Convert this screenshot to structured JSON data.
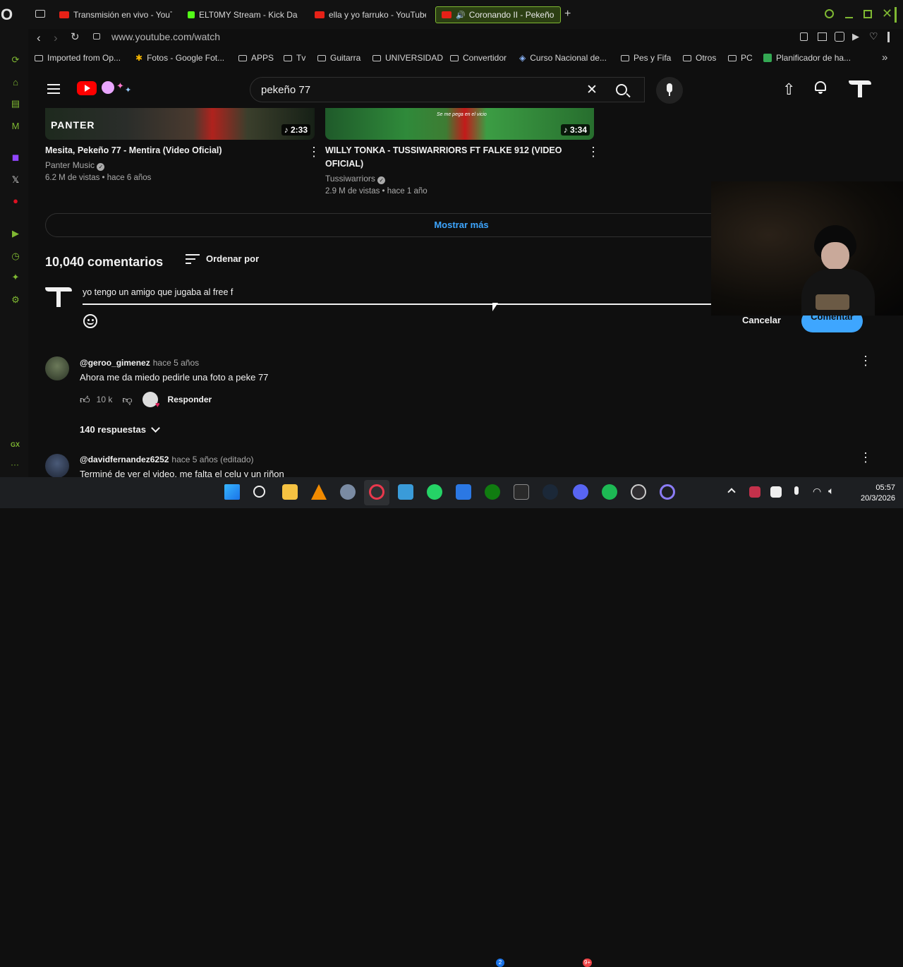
{
  "browser": {
    "tabs": [
      {
        "label": "Transmisión en vivo - YouT",
        "favicon_color": "#e62117",
        "active": false
      },
      {
        "label": "ELT0MY Stream - Kick Da",
        "favicon_color": "#53fc18",
        "active": false
      },
      {
        "label": "ella y yo farruko - YouTube",
        "favicon_color": "#e62117",
        "active": false
      },
      {
        "label": "Coronando II - Pekeño",
        "favicon_color": "#e62117",
        "active": true
      }
    ],
    "new_tab_label": "+",
    "url": "www.youtube.com/watch",
    "bookmarks": [
      "Imported from Op...",
      "Fotos - Google Fot...",
      "APPS",
      "Tv",
      "Guitarra",
      "UNIVERSIDAD",
      "Convertidor",
      "Curso Nacional de...",
      "Pes y Fifa",
      "Otros",
      "PC",
      "Planificador de ha..."
    ],
    "sidebar_label": "GX",
    "accent_color": "#7fb832"
  },
  "youtube": {
    "search_query": "pekeño 77",
    "related_videos": [
      {
        "title_line1": "Mesita, Pekeño 77 - Mentira (Video Oficial)",
        "title_line2": "",
        "channel": "Panter Music",
        "meta": "6.2 M de vistas • hace 6 años",
        "duration": "2:33",
        "thumb_text": "PANTER"
      },
      {
        "title_line1": "WILLY TONKA - TUSSIWARRIORS FT FALKE 912 (VIDEO",
        "title_line2": "OFICIAL)",
        "channel": "Tussiwarriors",
        "meta": "2.9 M de vistas • hace 1 año",
        "duration": "3:34",
        "thumb_text": "Se me pega en el vicio"
      }
    ],
    "show_more_label": "Mostrar más",
    "comments_count": "10,040 comentarios",
    "sort_label": "Ordenar por",
    "comment_draft": "yo tengo un amigo que jugaba al free f",
    "cancel_label": "Cancelar",
    "submit_label": "Comentar",
    "comments": [
      {
        "author": "@geroo_gimenez",
        "time": "hace 5 años",
        "text": "Ahora me da miedo pedirle una foto a peke 77",
        "likes": "10 k",
        "reply_label": "Responder",
        "replies_label": "140 respuestas"
      },
      {
        "author": "@davidfernandez6252",
        "time": "hace 5 años (editado)",
        "text": "Terminé de ver el video, me falta el celu y un riñon",
        "likes": "",
        "reply_label": "",
        "replies_label": ""
      }
    ]
  },
  "taskbar": {
    "time": "05:57",
    "date": "20/3/2026",
    "xbox_badge": "2",
    "discord_badge": "9+"
  }
}
